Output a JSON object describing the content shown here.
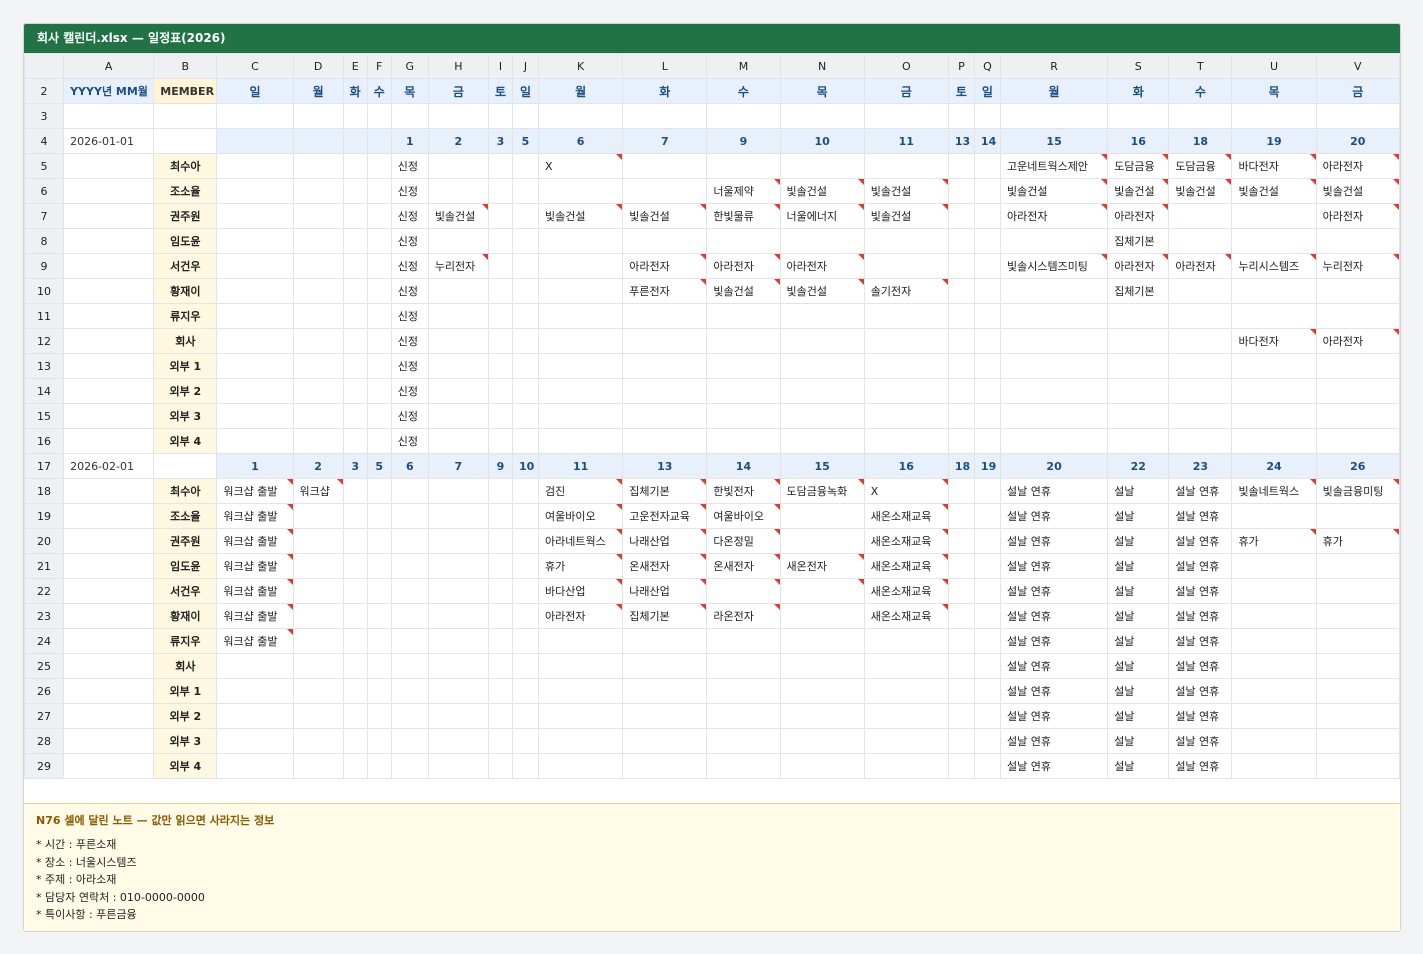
{
  "window_title": "회사 캘린더.xlsx — 일정표(2026)",
  "columns": [
    "A",
    "B",
    "C",
    "D",
    "E",
    "F",
    "G",
    "H",
    "I",
    "J",
    "K",
    "L",
    "M",
    "N",
    "O",
    "P",
    "Q",
    "R",
    "S",
    "T",
    "U",
    "V"
  ],
  "row2": {
    "rownum": "2",
    "a": "YYYY년 MM월",
    "b": "MEMBER",
    "days": [
      "일",
      "월",
      "화",
      "수",
      "목",
      "금",
      "토",
      "일",
      "월",
      "화",
      "수",
      "목",
      "금",
      "토",
      "일",
      "월",
      "화",
      "수",
      "목",
      "금"
    ]
  },
  "row3": {
    "rownum": "3"
  },
  "month1": {
    "header": {
      "rownum": "4",
      "date": "2026-01-01",
      "days": [
        "",
        "",
        "",
        "",
        "1",
        "2",
        "3",
        "5",
        "6",
        "7",
        "9",
        "10",
        "11",
        "13",
        "14",
        "15",
        "16",
        "18",
        "19",
        "20"
      ]
    },
    "rows": [
      {
        "rownum": "5",
        "member": "최수아",
        "cells": [
          "",
          "",
          "",
          "",
          "신정",
          "",
          "",
          "",
          "X",
          "",
          "",
          "",
          "",
          "",
          "",
          "고운네트웍스제안",
          "도담금융",
          "도담금융",
          "바다전자",
          "아라전자"
        ]
      },
      {
        "rownum": "6",
        "member": "조소율",
        "cells": [
          "",
          "",
          "",
          "",
          "신정",
          "",
          "",
          "",
          "",
          "",
          "너울제약",
          "빛솔건설",
          "빛솔건설",
          "",
          "",
          "빛솔건설",
          "빛솔건설",
          "빛솔건설",
          "빛솔건설",
          "빛솔건설"
        ]
      },
      {
        "rownum": "7",
        "member": "권주원",
        "cells": [
          "",
          "",
          "",
          "",
          "신정",
          "빛솔건설",
          "",
          "",
          "빛솔건설",
          "빛솔건설",
          "한빛물류",
          "너울에너지",
          "빛솔건설",
          "",
          "",
          "아라전자",
          "아라전자",
          "",
          "",
          "아라전자"
        ]
      },
      {
        "rownum": "8",
        "member": "임도윤",
        "cells": [
          "",
          "",
          "",
          "",
          "신정",
          "",
          "",
          "",
          "",
          "",
          "",
          "",
          "",
          "",
          "",
          "",
          "집체기본",
          "",
          "",
          ""
        ]
      },
      {
        "rownum": "9",
        "member": "서건우",
        "cells": [
          "",
          "",
          "",
          "",
          "신정",
          "누리전자",
          "",
          "",
          "",
          "아라전자",
          "아라전자",
          "아라전자",
          "",
          "",
          "",
          "빛솔시스템즈미팅",
          "아라전자",
          "아라전자",
          "누리시스템즈",
          "누리전자"
        ]
      },
      {
        "rownum": "10",
        "member": "황재이",
        "cells": [
          "",
          "",
          "",
          "",
          "신정",
          "",
          "",
          "",
          "",
          "푸른전자",
          "빛솔건설",
          "빛솔건설",
          "솔기전자",
          "",
          "",
          "",
          "집체기본",
          "",
          "",
          ""
        ]
      },
      {
        "rownum": "11",
        "member": "류지우",
        "cells": [
          "",
          "",
          "",
          "",
          "신정",
          "",
          "",
          "",
          "",
          "",
          "",
          "",
          "",
          "",
          "",
          "",
          "",
          "",
          "",
          ""
        ]
      },
      {
        "rownum": "12",
        "member": "회사",
        "cells": [
          "",
          "",
          "",
          "",
          "신정",
          "",
          "",
          "",
          "",
          "",
          "",
          "",
          "",
          "",
          "",
          "",
          "",
          "",
          "바다전자",
          "아라전자"
        ]
      },
      {
        "rownum": "13",
        "member": "외부 1",
        "cells": [
          "",
          "",
          "",
          "",
          "신정",
          "",
          "",
          "",
          "",
          "",
          "",
          "",
          "",
          "",
          "",
          "",
          "",
          "",
          "",
          ""
        ]
      },
      {
        "rownum": "14",
        "member": "외부 2",
        "cells": [
          "",
          "",
          "",
          "",
          "신정",
          "",
          "",
          "",
          "",
          "",
          "",
          "",
          "",
          "",
          "",
          "",
          "",
          "",
          "",
          ""
        ]
      },
      {
        "rownum": "15",
        "member": "외부 3",
        "cells": [
          "",
          "",
          "",
          "",
          "신정",
          "",
          "",
          "",
          "",
          "",
          "",
          "",
          "",
          "",
          "",
          "",
          "",
          "",
          "",
          ""
        ]
      },
      {
        "rownum": "16",
        "member": "외부 4",
        "cells": [
          "",
          "",
          "",
          "",
          "신정",
          "",
          "",
          "",
          "",
          "",
          "",
          "",
          "",
          "",
          "",
          "",
          "",
          "",
          "",
          ""
        ]
      }
    ]
  },
  "month2": {
    "header": {
      "rownum": "17",
      "date": "2026-02-01",
      "days": [
        "1",
        "2",
        "3",
        "5",
        "6",
        "7",
        "9",
        "10",
        "11",
        "13",
        "14",
        "15",
        "16",
        "18",
        "19",
        "20",
        "22",
        "23",
        "24",
        "26"
      ]
    },
    "rows": [
      {
        "rownum": "18",
        "member": "최수아",
        "cells": [
          "워크샵 출발",
          "워크샵",
          "",
          "",
          "",
          "",
          "",
          "",
          "검진",
          "집체기본",
          "한빛전자",
          "도담금융녹화",
          "X",
          "",
          "",
          "설날 연휴",
          "설날",
          "설날 연휴",
          "빛솔네트웍스",
          "빛솔금융미팅"
        ]
      },
      {
        "rownum": "19",
        "member": "조소율",
        "cells": [
          "워크샵 출발",
          "",
          "",
          "",
          "",
          "",
          "",
          "",
          "여울바이오",
          "고운전자교육",
          "여울바이오",
          "",
          "새온소재교육",
          "",
          "",
          "설날 연휴",
          "설날",
          "설날 연휴",
          "",
          ""
        ]
      },
      {
        "rownum": "20",
        "member": "권주원",
        "cells": [
          "워크샵 출발",
          "",
          "",
          "",
          "",
          "",
          "",
          "",
          "아라네트웍스",
          "나래산업",
          "다온정밀",
          "",
          "새온소재교육",
          "",
          "",
          "설날 연휴",
          "설날",
          "설날 연휴",
          "휴가",
          "휴가"
        ]
      },
      {
        "rownum": "21",
        "member": "임도윤",
        "cells": [
          "워크샵 출발",
          "",
          "",
          "",
          "",
          "",
          "",
          "",
          "휴가",
          "온새전자",
          "온새전자",
          "새온전자",
          "새온소재교육",
          "",
          "",
          "설날 연휴",
          "설날",
          "설날 연휴",
          "",
          ""
        ]
      },
      {
        "rownum": "22",
        "member": "서건우",
        "cells": [
          "워크샵 출발",
          "",
          "",
          "",
          "",
          "",
          "",
          "",
          "바다산업",
          "나래산업",
          "",
          "",
          "새온소재교육",
          "",
          "",
          "설날 연휴",
          "설날",
          "설날 연휴",
          "",
          ""
        ]
      },
      {
        "rownum": "23",
        "member": "황재이",
        "cells": [
          "워크샵 출발",
          "",
          "",
          "",
          "",
          "",
          "",
          "",
          "아라전자",
          "집체기본",
          "라온전자",
          "",
          "새온소재교육",
          "",
          "",
          "설날 연휴",
          "설날",
          "설날 연휴",
          "",
          ""
        ]
      },
      {
        "rownum": "24",
        "member": "류지우",
        "cells": [
          "워크샵 출발",
          "",
          "",
          "",
          "",
          "",
          "",
          "",
          "",
          "",
          "",
          "",
          "",
          "",
          "",
          "설날 연휴",
          "설날",
          "설날 연휴",
          "",
          ""
        ]
      },
      {
        "rownum": "25",
        "member": "회사",
        "cells": [
          "",
          "",
          "",
          "",
          "",
          "",
          "",
          "",
          "",
          "",
          "",
          "",
          "",
          "",
          "",
          "설날 연휴",
          "설날",
          "설날 연휴",
          "",
          ""
        ]
      },
      {
        "rownum": "26",
        "member": "외부 1",
        "cells": [
          "",
          "",
          "",
          "",
          "",
          "",
          "",
          "",
          "",
          "",
          "",
          "",
          "",
          "",
          "",
          "설날 연휴",
          "설날",
          "설날 연휴",
          "",
          ""
        ]
      },
      {
        "rownum": "27",
        "member": "외부 2",
        "cells": [
          "",
          "",
          "",
          "",
          "",
          "",
          "",
          "",
          "",
          "",
          "",
          "",
          "",
          "",
          "",
          "설날 연휴",
          "설날",
          "설날 연휴",
          "",
          ""
        ]
      },
      {
        "rownum": "28",
        "member": "외부 3",
        "cells": [
          "",
          "",
          "",
          "",
          "",
          "",
          "",
          "",
          "",
          "",
          "",
          "",
          "",
          "",
          "",
          "설날 연휴",
          "설날",
          "설날 연휴",
          "",
          ""
        ]
      },
      {
        "rownum": "29",
        "member": "외부 4",
        "cells": [
          "",
          "",
          "",
          "",
          "",
          "",
          "",
          "",
          "",
          "",
          "",
          "",
          "",
          "",
          "",
          "설날 연휴",
          "설날",
          "설날 연휴",
          "",
          ""
        ]
      }
    ]
  },
  "note": {
    "title": "N76 셀에 달린 노트 — 값만 읽으면 사라지는 정보",
    "lines": [
      "* 시간 : 푸른소재",
      "* 장소 : 너울시스템즈",
      "* 주제 : 아라소재",
      "* 담당자 연락처 : 010-0000-0000",
      "* 특이사항 : 푸른금융"
    ]
  },
  "colors": {
    "title_bar": "#217346",
    "day_header_bg": "#e8f1fb",
    "member_bg": "#fff8e0",
    "note_marker": "#e23b2e",
    "note_bg": "#fffbe6"
  }
}
